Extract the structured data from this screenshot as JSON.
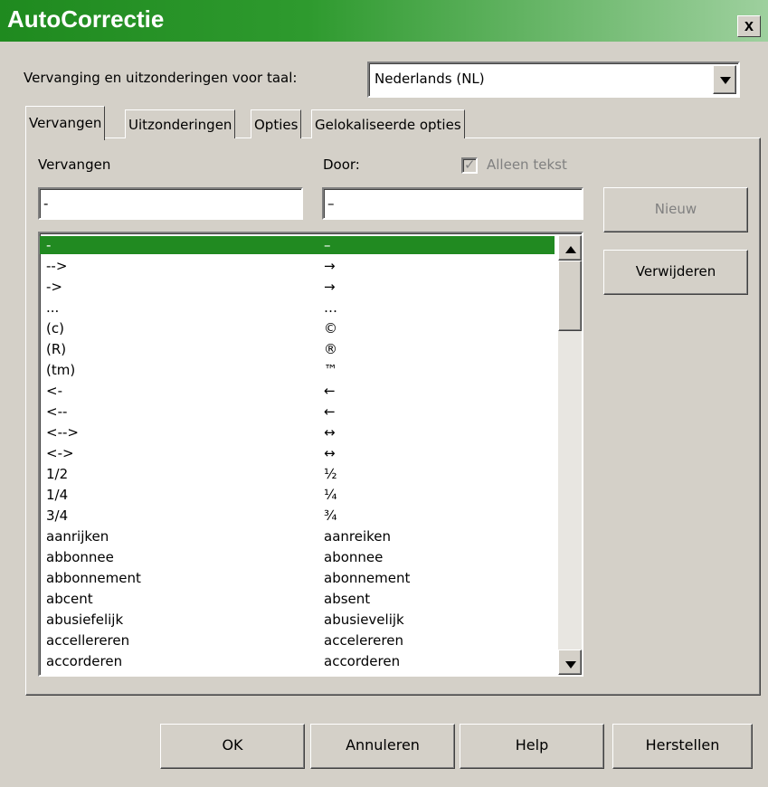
{
  "window": {
    "title": "AutoCorrectie",
    "close_label": "x"
  },
  "language": {
    "label": "Vervanging en uitzonderingen voor taal:",
    "value": "Nederlands (NL)"
  },
  "tabs": [
    {
      "label": "Vervangen",
      "active": true
    },
    {
      "label": "Uitzonderingen",
      "active": false
    },
    {
      "label": "Opties",
      "active": false
    },
    {
      "label": "Gelokaliseerde opties",
      "active": false
    }
  ],
  "replace": {
    "col1_label": "Vervangen",
    "col2_label": "Door:",
    "text_only_label": "Alleen tekst",
    "text_only_checked": true,
    "input1_value": "-",
    "input2_value": "–",
    "new_button": "Nieuw",
    "delete_button": "Verwijderen",
    "rows": [
      [
        "-",
        "–"
      ],
      [
        "-->",
        "→"
      ],
      [
        "->",
        "→"
      ],
      [
        "...",
        "…"
      ],
      [
        "(c)",
        "©"
      ],
      [
        "(R)",
        "®"
      ],
      [
        "(tm)",
        "™"
      ],
      [
        "<-",
        "←"
      ],
      [
        "<--",
        "←"
      ],
      [
        "<-->",
        "↔"
      ],
      [
        "<->",
        "↔"
      ],
      [
        "1/2",
        "½"
      ],
      [
        "1/4",
        "¼"
      ],
      [
        "3/4",
        "¾"
      ],
      [
        "aanrijken",
        "aanreiken"
      ],
      [
        "abbonnee",
        "abonnee"
      ],
      [
        "abbonnement",
        "abonnement"
      ],
      [
        "abcent",
        "absent"
      ],
      [
        "abusiefelijk",
        "abusievelijk"
      ],
      [
        "accellereren",
        "accelereren"
      ],
      [
        "accorderen",
        "accorderen"
      ]
    ]
  },
  "buttons": {
    "ok": "OK",
    "cancel": "Annuleren",
    "help": "Help",
    "reset": "Herstellen"
  }
}
